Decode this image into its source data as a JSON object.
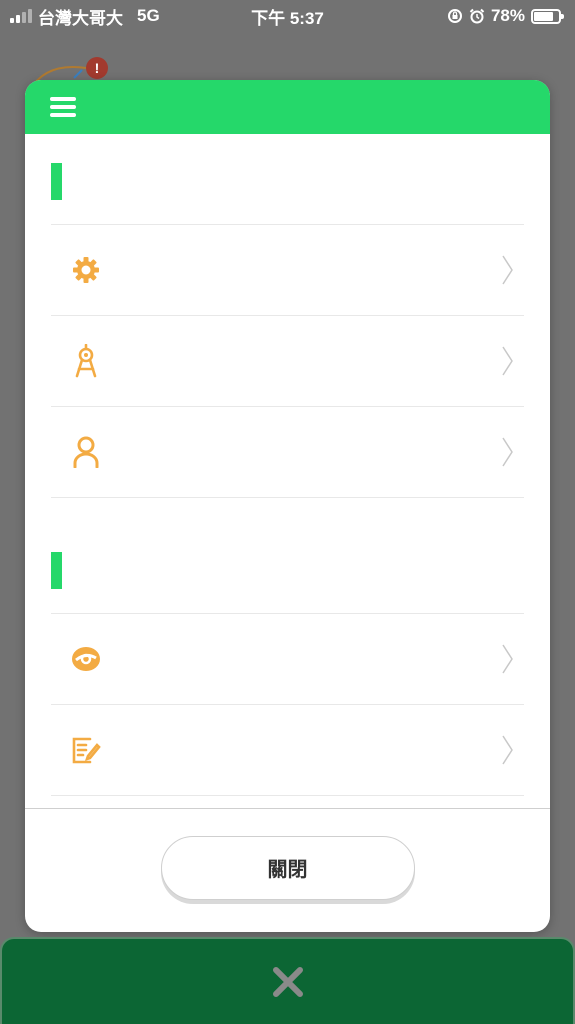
{
  "status_bar": {
    "carrier": "台灣大哥大",
    "network": "5G",
    "time": "下午 5:37",
    "battery": "78%",
    "battery_level": 0.78
  },
  "background": {
    "badge": "!"
  },
  "menu": {
    "sections": [
      {
        "title": "",
        "items": [
          {
            "label": "",
            "icon": "gear-icon"
          },
          {
            "label": "",
            "icon": "compass-icon"
          },
          {
            "label": "",
            "icon": "user-icon"
          }
        ]
      },
      {
        "title": "",
        "items": [
          {
            "label": "",
            "icon": "link-icon"
          },
          {
            "label": "",
            "icon": "edit-note-icon"
          }
        ]
      }
    ],
    "close_label": "關閉"
  },
  "colors": {
    "accent": "#25d86a",
    "icon": "#f3ab43",
    "bottom_bar": "#0c6634"
  }
}
